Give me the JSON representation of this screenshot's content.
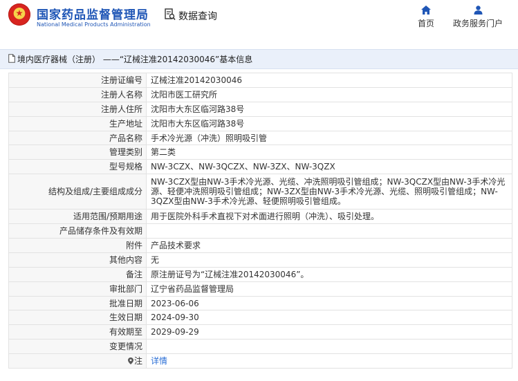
{
  "header": {
    "brand_cn": "国家药品监督管理局",
    "brand_en": "National Medical Products Administration",
    "query_label": "数据查询",
    "nav": [
      {
        "label": "首页",
        "icon": "home-icon"
      },
      {
        "label": "政务服务门户",
        "icon": "user-icon"
      }
    ]
  },
  "title": "境内医疗器械（注册） ——“辽械注准20142030046”基本信息",
  "rows": [
    {
      "key": "注册证编号",
      "value": "辽械注准20142030046"
    },
    {
      "key": "注册人名称",
      "value": "沈阳市医工研究所"
    },
    {
      "key": "注册人住所",
      "value": "沈阳市大东区临河路38号"
    },
    {
      "key": "生产地址",
      "value": "沈阳市大东区临河路38号"
    },
    {
      "key": "产品名称",
      "value": "手术冷光源（冲洗）照明吸引管"
    },
    {
      "key": "管理类别",
      "value": "第二类"
    },
    {
      "key": "型号规格",
      "value": "NW-3CZX、NW-3QCZX、NW-3ZX、NW-3QZX"
    },
    {
      "key": "结构及组成/主要组成成分",
      "value": "NW-3CZX型由NW-3手术冷光源、光缆、冲洗照明吸引管组成；NW-3QCZX型由NW-3手术冷光源、轻便冲洗照明吸引管组成；NW-3ZX型由NW-3手术冷光源、光缆、照明吸引管组成；NW-3QZX型由NW-3手术冷光源、轻便照明吸引管组成。"
    },
    {
      "key": "适用范围/预期用途",
      "value": "用于医院外科手术直视下对术面进行照明（冲洗）、吸引处理。"
    },
    {
      "key": "产品储存条件及有效期",
      "value": ""
    },
    {
      "key": "附件",
      "value": "产品技术要求"
    },
    {
      "key": "其他内容",
      "value": "无"
    },
    {
      "key": "备注",
      "value": "原注册证号为“辽械注准20142030046”。"
    },
    {
      "key": "审批部门",
      "value": "辽宁省药品监督管理局"
    },
    {
      "key": "批准日期",
      "value": "2023-06-06"
    },
    {
      "key": "生效日期",
      "value": "2024-09-30"
    },
    {
      "key": "有效期至",
      "value": "2029-09-29"
    },
    {
      "key": "变更情况",
      "value": ""
    }
  ],
  "note_row": {
    "key": "注",
    "link": "详情"
  },
  "colors": {
    "brand": "#1f56b6",
    "link": "#2b6fd6",
    "title_bg": "#eaf0fa"
  }
}
